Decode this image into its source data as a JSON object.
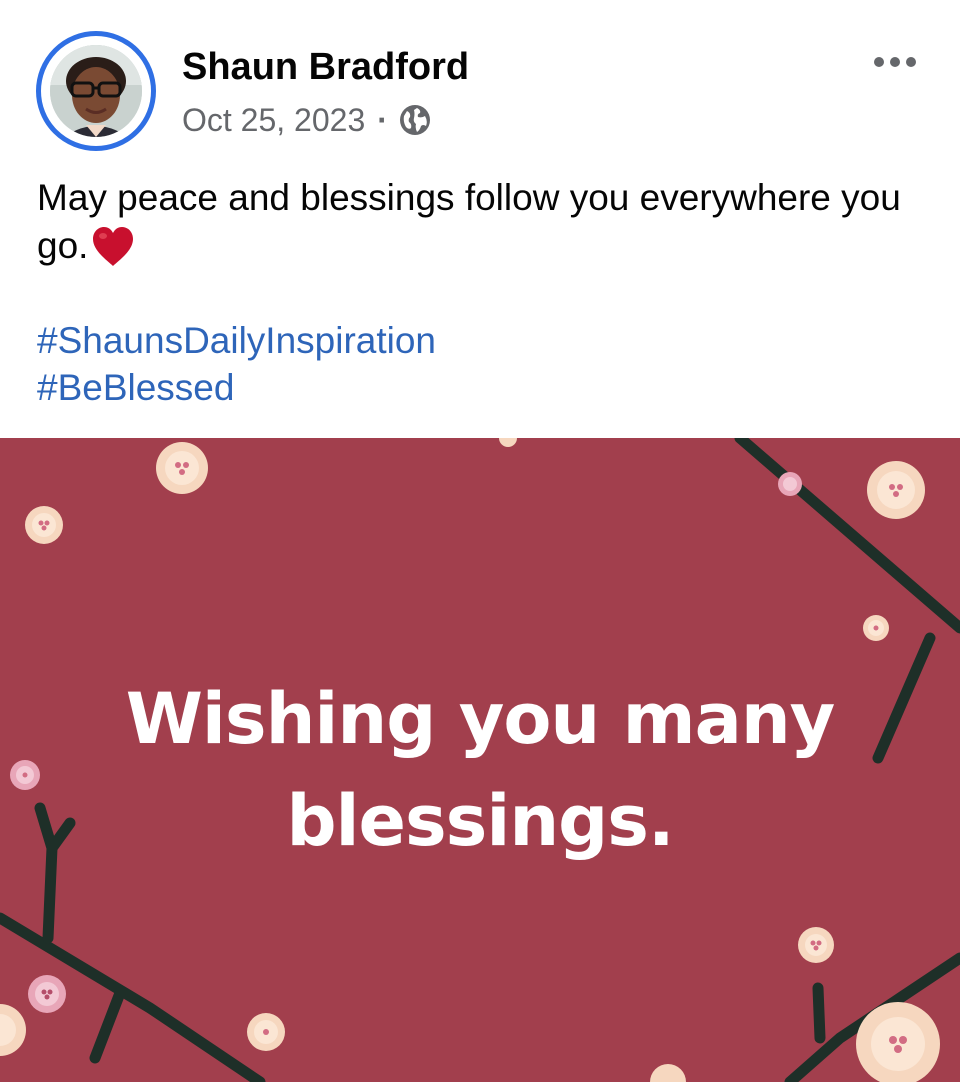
{
  "post": {
    "author": {
      "name": "Shaun Bradford",
      "avatar_icon": "profile-photo"
    },
    "date": "Oct 25, 2023",
    "separator": "·",
    "audience_icon": "globe-icon",
    "more_icon": "more-options-icon",
    "text": "May peace and blessings follow you everywhere you go.",
    "emoji": "heart-emoji",
    "hashtags": [
      "#ShaunsDailyInspiration",
      "#BeBlessed"
    ],
    "image": {
      "caption_line1": "Wishing you many",
      "caption_line2": "blessings.",
      "background_color": "#a23f4d",
      "text_color": "#ffffff"
    }
  },
  "colors": {
    "avatar_ring": "#2f6fe4",
    "hashtag": "#2e65b9",
    "secondary_text": "#65676b"
  }
}
